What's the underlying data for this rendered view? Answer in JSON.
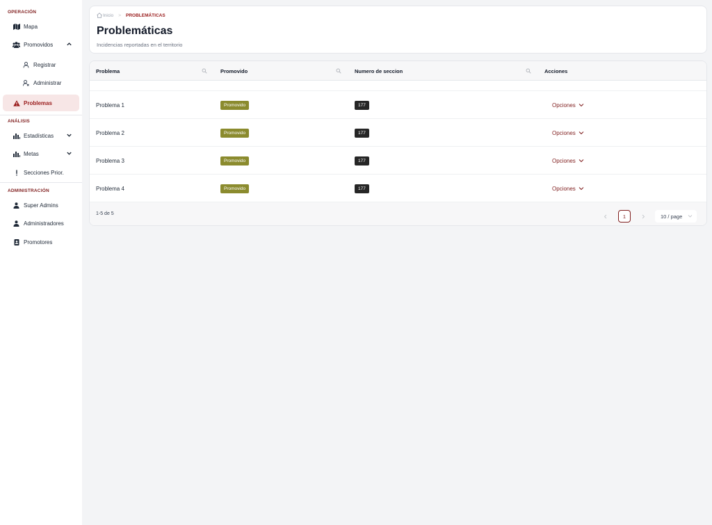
{
  "sidebar": {
    "sections": {
      "operacion": "OPERACIÓN",
      "analisis": "ANÁLISIS",
      "administracion": "ADMINISTRACIÓN"
    },
    "items": {
      "mapa": "Mapa",
      "promovidos": "Promovidos",
      "registrar": "Registrar",
      "administrar": "Administrar",
      "problemas": "Problemas",
      "estadisticas": "Estadísticas",
      "metas": "Metas",
      "secciones": "Secciones Prior.",
      "super_admins": "Super Admins",
      "administradores": "Administradores",
      "promotores": "Promotores"
    }
  },
  "header": {
    "breadcrumb_home": "Inicio",
    "breadcrumb_current": "PROBLEMÁTICAS",
    "title": "Problemáticas",
    "subtitle": "Incidencias reportadas en el territorio"
  },
  "table": {
    "columns": {
      "problema": "Problema",
      "promovido": "Promovido",
      "seccion": "Numero de seccion",
      "acciones": "Acciones"
    },
    "rows": [
      {
        "problema": "Problema 1",
        "promovido": "Promovido",
        "seccion": "177",
        "accion": "Opciones"
      },
      {
        "problema": "Problema 2",
        "promovido": "Promovido",
        "seccion": "177",
        "accion": "Opciones"
      },
      {
        "problema": "Problema 3",
        "promovido": "Promovido",
        "seccion": "177",
        "accion": "Opciones"
      },
      {
        "problema": "Problema 4",
        "promovido": "Promovido",
        "seccion": "177",
        "accion": "Opciones"
      }
    ]
  },
  "pagination": {
    "range": "1-5 de 5",
    "current_page": "1",
    "page_size": "10 / page"
  },
  "colors": {
    "accent": "#7f1d1d",
    "active_bg": "#f7e6e6",
    "promovido_badge": "#8b8b2e",
    "seccion_badge": "#262626"
  }
}
